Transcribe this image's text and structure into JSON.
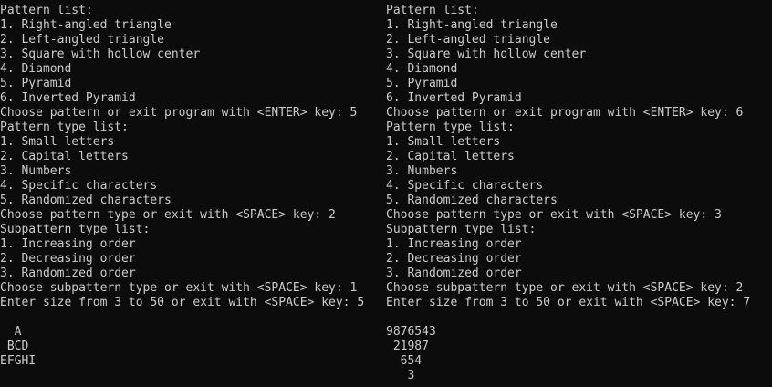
{
  "consoles": [
    {
      "lines": [
        "Pattern list:",
        "1. Right-angled triangle",
        "2. Left-angled triangle",
        "3. Square with hollow center",
        "4. Diamond",
        "5. Pyramid",
        "6. Inverted Pyramid",
        "Choose pattern or exit program with <ENTER> key: 5",
        "Pattern type list:",
        "1. Small letters",
        "2. Capital letters",
        "3. Numbers",
        "4. Specific characters",
        "5. Randomized characters",
        "Choose pattern type or exit with <SPACE> key: 2",
        "Subpattern type list:",
        "1. Increasing order",
        "2. Decreasing order",
        "3. Randomized order",
        "Choose subpattern type or exit with <SPACE> key: 1",
        "Enter size from 3 to 50 or exit with <SPACE> key: 5",
        "",
        "  A",
        " BCD",
        "EFGHI"
      ]
    },
    {
      "lines": [
        "Pattern list:",
        "1. Right-angled triangle",
        "2. Left-angled triangle",
        "3. Square with hollow center",
        "4. Diamond",
        "5. Pyramid",
        "6. Inverted Pyramid",
        "Choose pattern or exit program with <ENTER> key: 6",
        "Pattern type list:",
        "1. Small letters",
        "2. Capital letters",
        "3. Numbers",
        "4. Specific characters",
        "5. Randomized characters",
        "Choose pattern type or exit with <SPACE> key: 3",
        "Subpattern type list:",
        "1. Increasing order",
        "2. Decreasing order",
        "3. Randomized order",
        "Choose subpattern type or exit with <SPACE> key: 2",
        "Enter size from 3 to 50 or exit with <SPACE> key: 7",
        "",
        "9876543",
        " 21987",
        "  654",
        "   3"
      ]
    }
  ]
}
